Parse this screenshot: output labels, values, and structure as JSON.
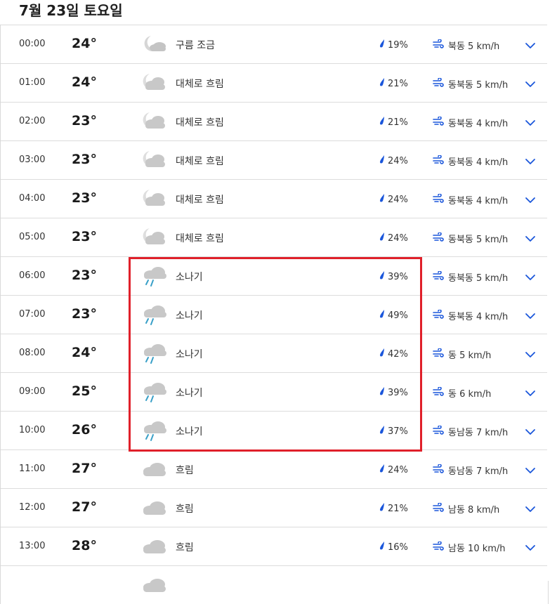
{
  "header": {
    "title": "7월 23일 토요일"
  },
  "rows": [
    {
      "time": "00:00",
      "temp": "24°",
      "icon": "night-partly-cloudy",
      "condition": "구름 조금",
      "precip": "19%",
      "wind": "북동 5 km/h"
    },
    {
      "time": "01:00",
      "temp": "24°",
      "icon": "night-mostly-cloudy",
      "condition": "대체로 흐림",
      "precip": "21%",
      "wind": "동북동 5 km/h"
    },
    {
      "time": "02:00",
      "temp": "23°",
      "icon": "night-mostly-cloudy",
      "condition": "대체로 흐림",
      "precip": "21%",
      "wind": "동북동 4 km/h"
    },
    {
      "time": "03:00",
      "temp": "23°",
      "icon": "night-mostly-cloudy",
      "condition": "대체로 흐림",
      "precip": "24%",
      "wind": "동북동 4 km/h"
    },
    {
      "time": "04:00",
      "temp": "23°",
      "icon": "night-mostly-cloudy",
      "condition": "대체로 흐림",
      "precip": "24%",
      "wind": "동북동 4 km/h"
    },
    {
      "time": "05:00",
      "temp": "23°",
      "icon": "night-mostly-cloudy",
      "condition": "대체로 흐림",
      "precip": "24%",
      "wind": "동북동 5 km/h"
    },
    {
      "time": "06:00",
      "temp": "23°",
      "icon": "showers",
      "condition": "소나기",
      "precip": "39%",
      "wind": "동북동 5 km/h"
    },
    {
      "time": "07:00",
      "temp": "23°",
      "icon": "showers",
      "condition": "소나기",
      "precip": "49%",
      "wind": "동북동 4 km/h"
    },
    {
      "time": "08:00",
      "temp": "24°",
      "icon": "showers",
      "condition": "소나기",
      "precip": "42%",
      "wind": "동 5 km/h"
    },
    {
      "time": "09:00",
      "temp": "25°",
      "icon": "showers",
      "condition": "소나기",
      "precip": "39%",
      "wind": "동 6 km/h"
    },
    {
      "time": "10:00",
      "temp": "26°",
      "icon": "showers",
      "condition": "소나기",
      "precip": "37%",
      "wind": "동남동 7 km/h"
    },
    {
      "time": "11:00",
      "temp": "27°",
      "icon": "cloudy",
      "condition": "흐림",
      "precip": "24%",
      "wind": "동남동 7 km/h"
    },
    {
      "time": "12:00",
      "temp": "27°",
      "icon": "cloudy",
      "condition": "흐림",
      "precip": "21%",
      "wind": "남동 8 km/h"
    },
    {
      "time": "13:00",
      "temp": "28°",
      "icon": "cloudy",
      "condition": "흐림",
      "precip": "16%",
      "wind": "남동 10 km/h"
    },
    {
      "time": "",
      "temp": "",
      "icon": "cloudy",
      "condition": "",
      "precip": "",
      "wind": ""
    }
  ],
  "colors": {
    "accent_blue": "#1a56db",
    "highlight_red": "#e0202a",
    "icon_gray": "#c8c8c8"
  }
}
